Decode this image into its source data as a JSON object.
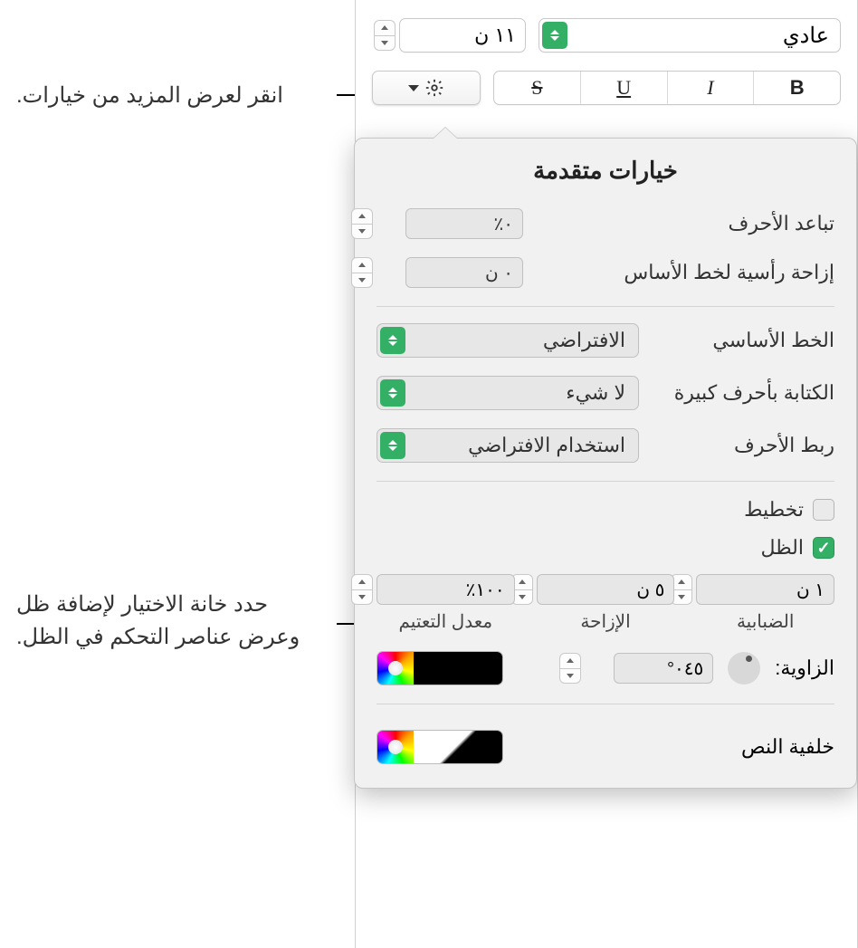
{
  "toolbar": {
    "font_style": "عادي",
    "font_size": "١١ ن",
    "bold": "B",
    "italic": "I",
    "underline": "U",
    "strike": "S"
  },
  "callouts": {
    "gear": "انقر لعرض المزيد من خيارات.",
    "shadow": "حدد خانة الاختيار لإضافة ظل وعرض عناصر التحكم في الظل."
  },
  "popover": {
    "title": "خيارات متقدمة",
    "char_spacing_label": "تباعد الأحرف",
    "char_spacing_value": "٠٪",
    "baseline_shift_label": "إزاحة رأسية لخط الأساس",
    "baseline_shift_value": "٠ ن",
    "baseline_label": "الخط الأساسي",
    "baseline_value": "الافتراضي",
    "caps_label": "الكتابة بأحرف كبيرة",
    "caps_value": "لا شيء",
    "ligatures_label": "ربط الأحرف",
    "ligatures_value": "استخدام الافتراضي",
    "outline_label": "تخطيط",
    "shadow_label": "الظل",
    "shadow": {
      "blur_label": "الضبابية",
      "blur_value": "١ ن",
      "offset_label": "الإزاحة",
      "offset_value": "٥ ن",
      "opacity_label": "معدل التعتيم",
      "opacity_value": "١٠٠٪",
      "angle_label": "الزاوية:",
      "angle_value": "٠٤٥°"
    },
    "textbg_label": "خلفية النص"
  }
}
